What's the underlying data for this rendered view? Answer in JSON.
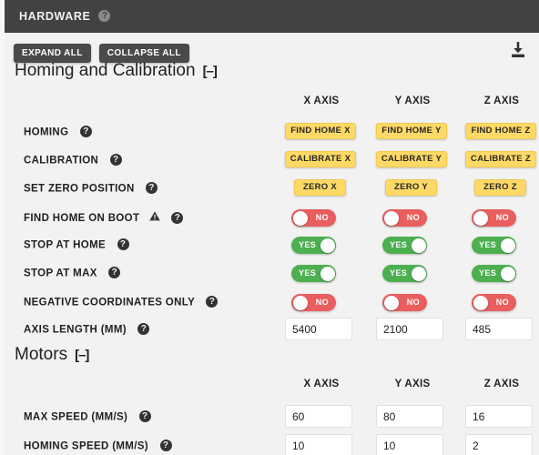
{
  "titlebar": {
    "title": "HARDWARE",
    "help_icon": "help-circle-icon"
  },
  "toolbar": {
    "expand_all": "EXPAND ALL",
    "collapse_all": "COLLAPSE ALL",
    "download_icon": "download-icon"
  },
  "sections": [
    {
      "title": "Homing and Calibration",
      "collapse_marker": "[–]",
      "columns": [
        "X AXIS",
        "Y AXIS",
        "Z AXIS"
      ],
      "rows": [
        {
          "label": "HOMING",
          "type": "buttons",
          "values": [
            "FIND HOME X",
            "FIND HOME Y",
            "FIND HOME Z"
          ]
        },
        {
          "label": "CALIBRATION",
          "type": "buttons",
          "values": [
            "CALIBRATE X",
            "CALIBRATE Y",
            "CALIBRATE Z"
          ]
        },
        {
          "label": "SET ZERO POSITION",
          "type": "buttons",
          "values": [
            "ZERO X",
            "ZERO Y",
            "ZERO Z"
          ]
        },
        {
          "label": "FIND HOME ON BOOT",
          "type": "toggles",
          "warning": true,
          "values": [
            "NO",
            "NO",
            "NO"
          ]
        },
        {
          "label": "STOP AT HOME",
          "type": "toggles",
          "values": [
            "YES",
            "YES",
            "YES"
          ]
        },
        {
          "label": "STOP AT MAX",
          "type": "toggles",
          "values": [
            "YES",
            "YES",
            "YES"
          ]
        },
        {
          "label": "NEGATIVE COORDINATES ONLY",
          "type": "toggles",
          "values": [
            "NO",
            "NO",
            "NO"
          ]
        },
        {
          "label": "AXIS LENGTH (MM)",
          "type": "inputs",
          "values": [
            "5400",
            "2100",
            "485"
          ]
        }
      ]
    },
    {
      "title": "Motors",
      "collapse_marker": "[–]",
      "columns": [
        "X AXIS",
        "Y AXIS",
        "Z AXIS"
      ],
      "rows": [
        {
          "label": "MAX SPEED (MM/S)",
          "type": "inputs",
          "values": [
            "60",
            "80",
            "16"
          ]
        },
        {
          "label": "HOMING SPEED (MM/S)",
          "type": "inputs",
          "values": [
            "10",
            "10",
            "2"
          ]
        }
      ]
    }
  ],
  "colors": {
    "titlebar_bg": "#424242",
    "page_bg": "#f2f2f2",
    "action_yellow": "#ffd965",
    "toggle_no_red": "#e95e5e",
    "toggle_yes_green": "#4caf50",
    "gray_button": "#4a4a4a"
  }
}
